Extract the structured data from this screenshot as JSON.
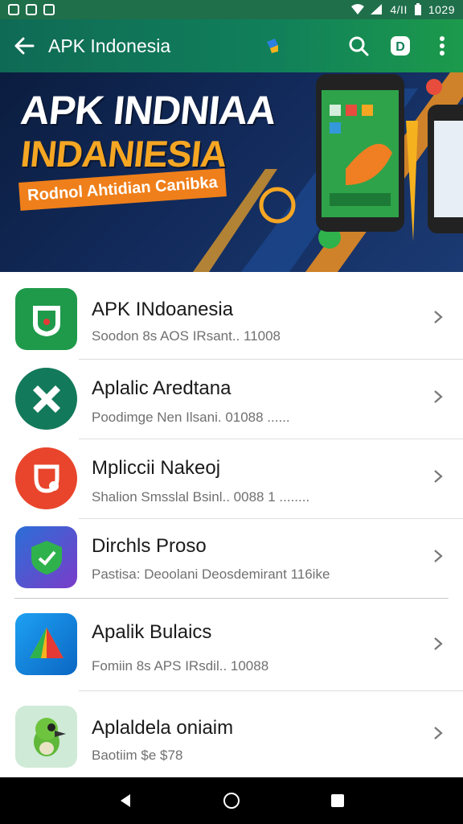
{
  "status_bar": {
    "time": "1029",
    "signal_text": "4/II"
  },
  "app_bar": {
    "title": "APK Indonesia",
    "back_icon": "arrow-left-icon",
    "search_icon": "search-icon",
    "account_icon": "account-badge-icon",
    "account_letter": "D",
    "menu_icon": "more-vert-icon"
  },
  "banner": {
    "title": "APK INDNIAA",
    "subtitle": "INDANIESIA",
    "tag": "Rodnol Ahtidian Canibka"
  },
  "apps": [
    {
      "title": "APK INdoanesia",
      "subtitle": "Soodon 8s AOS IRsant.. 11008",
      "icon": "shield-app-icon"
    },
    {
      "title": "Aplalic Aredtana",
      "subtitle": "Poodimge Nen Ilsani.  01088     ......",
      "icon": "wrench-app-icon"
    },
    {
      "title": "Mpliccii Nakeoj",
      "subtitle": "Shalion Smsslal Bsinl.. 0088    1 ........",
      "icon": "magnet-app-icon"
    },
    {
      "title": "Dirchls Proso",
      "subtitle": "Pastisa: Deoolani Deosdemirant 116ike",
      "icon": "shield-check-app-icon"
    },
    {
      "title": "Apalik Bulaics",
      "subtitle": "Fomiin 8s APS IRsdil.. 10088",
      "icon": "triangle-app-icon"
    },
    {
      "title": "Aplaldela oniaim",
      "subtitle": "Baotiim $e $78",
      "icon": "bird-app-icon"
    }
  ],
  "colors": {
    "app_bar": "#11805a",
    "accent_orange": "#f5a623",
    "banner_bg": "#122a5a"
  },
  "nav": {
    "back": "nav-back-icon",
    "home": "nav-home-icon",
    "recents": "nav-recents-icon"
  }
}
